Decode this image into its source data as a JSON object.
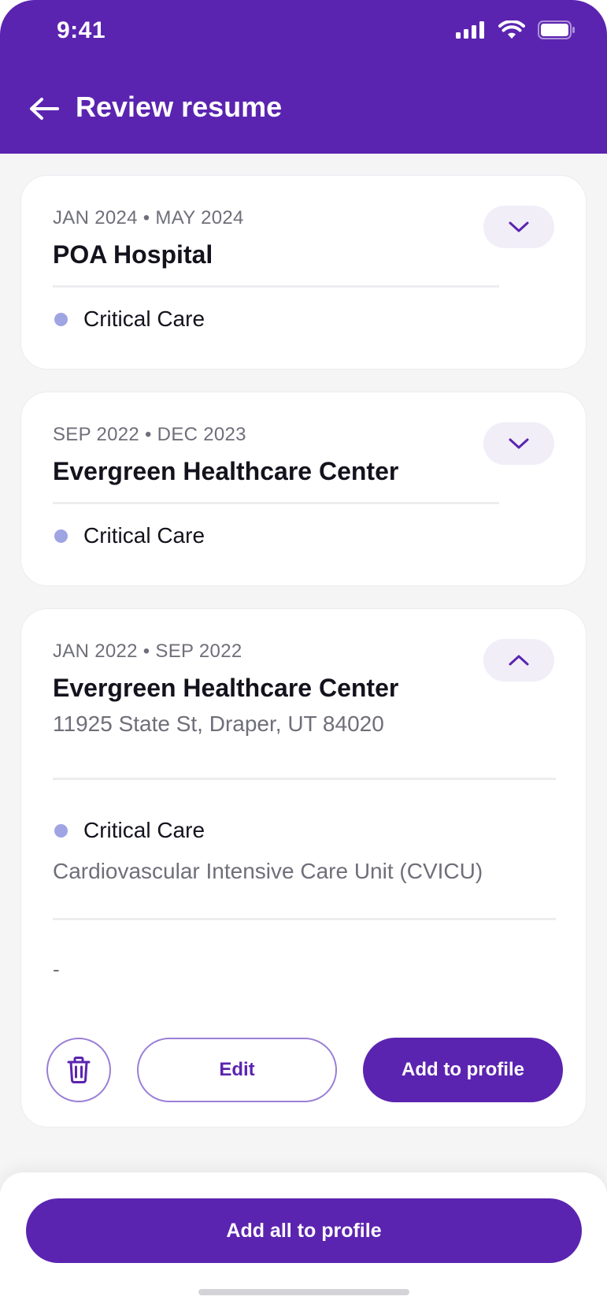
{
  "status_bar": {
    "time": "9:41"
  },
  "header": {
    "title": "Review resume"
  },
  "cards": [
    {
      "dates": "JAN 2024 • MAY 2024",
      "employer": "POA Hospital",
      "specialty": "Critical Care",
      "expanded": false
    },
    {
      "dates": "SEP 2022 • DEC 2023",
      "employer": "Evergreen Healthcare Center",
      "specialty": "Critical Care",
      "expanded": false
    },
    {
      "dates": "JAN 2022 • SEP 2022",
      "employer": "Evergreen Healthcare Center",
      "address": "11925 State St, Draper, UT 84020",
      "specialty": "Critical Care",
      "unit": "Cardiovascular Intensive Care Unit (CVICU)",
      "notes": "-",
      "expanded": true,
      "actions": {
        "edit_label": "Edit",
        "add_label": "Add to profile"
      }
    }
  ],
  "footer": {
    "add_all_label": "Add all to profile"
  },
  "colors": {
    "brand": "#5b24b0",
    "dot": "#9fa4e3",
    "background": "#f5f5f6"
  }
}
